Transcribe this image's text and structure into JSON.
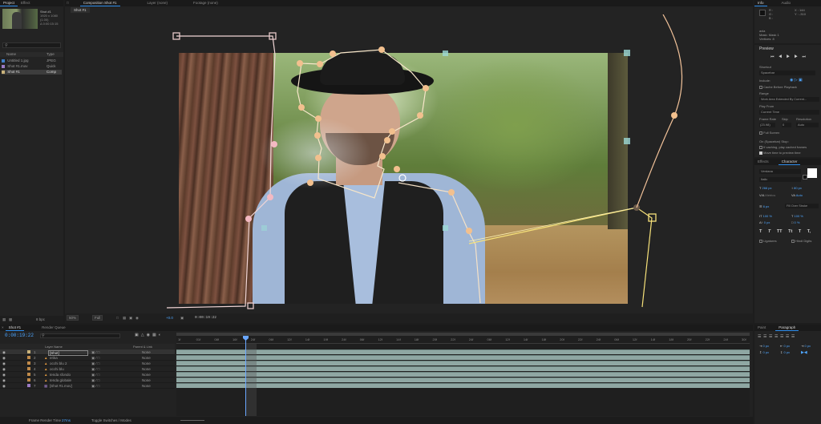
{
  "project": {
    "tabs": [
      "Project",
      "Effect"
    ],
    "thumb_name": "Shot #1",
    "thumb_info": "1920 x 1080 (1.00)",
    "thumb_time": "Δ 0:00:15:15",
    "col_name": "Name",
    "col_type": "Type",
    "items": [
      {
        "name": "Untitled 1.jpg",
        "type": "JPEG"
      },
      {
        "name": "Shot #1.mov",
        "type": "Quick"
      },
      {
        "name": "Shot #1",
        "type": "Comp"
      }
    ],
    "bpc": "8 bpc"
  },
  "viewer": {
    "tabs": [
      "Composition Shot #1",
      "Layer (none)",
      "Footage (none)"
    ],
    "subtab": "Shot #1",
    "zoom": "50%",
    "resolution": "Full",
    "timecode": "0:00:19:22",
    "exposure": "+0.0"
  },
  "right": {
    "info_tabs": [
      "Info",
      "Audio"
    ],
    "info_r": "R :",
    "info_g": "G :",
    "info_b": "B :",
    "info_x": "X : 144",
    "info_y": "Y : -310",
    "mask_lines": [
      "axia",
      "Mask: Mask 1",
      "Vertices: 8"
    ],
    "preview_tab": "Preview",
    "shortcut_label": "Shortcut",
    "shortcut_value": "Spacebar",
    "include_label": "Include:",
    "cache_label": "Cache Before Playback",
    "range_label": "Range",
    "range_value": "Work Area Extended By Current...",
    "playfrom_label": "Play From",
    "playfrom_value": "Current Time",
    "framerate_label": "Frame Rate",
    "skip_label": "Skip",
    "resolution_label": "Resolution",
    "framerate_value": "(23.98)",
    "skip_value": "0",
    "resolution_value": "Auto",
    "fullscreen_label": "Full Screen",
    "onstop_label": "On (Spacebar) Stop:",
    "ifcaching_label": "If caching, play cached frames",
    "movetime_label": "Move time to preview time",
    "char_tabs": [
      "Effects",
      "Character"
    ],
    "font_name": "Verdana",
    "font_style": "Italic",
    "font_size": "266 px",
    "leading": "80 px",
    "tracking": "Auto",
    "kerning": "Metrics",
    "stroke_size": "6 px",
    "stroke_mode": "Fill Over Stroke",
    "vscale": "100 %",
    "hscale": "100 %",
    "baseline": "0 px",
    "tsume": "0 %",
    "style_buttons": [
      "T",
      "T",
      "TT",
      "Tt",
      "T",
      "T,"
    ],
    "ligatures": "Ligatures",
    "hindi_digits": "Hindi Digits",
    "para_tabs": [
      "Paint",
      "Paragraph"
    ],
    "para_values": [
      "0 px",
      "0 px",
      "0 px",
      "0 px",
      "0 px"
    ]
  },
  "timeline": {
    "tabs": [
      "Shot #1",
      "Render Queue"
    ],
    "timecode": "0:00:19:22",
    "search_placeholder": "",
    "col_layer": "Layer Name",
    "col_parent": "Parent & Link",
    "layers": [
      {
        "num": "1",
        "name": "[Shot]",
        "parent": "None"
      },
      {
        "num": "2",
        "name": "erika",
        "parent": "None"
      },
      {
        "num": "3",
        "name": "occhi blu 2",
        "parent": "None"
      },
      {
        "num": "4",
        "name": "occhi blu",
        "parent": "None"
      },
      {
        "num": "5",
        "name": "tenda sfondo",
        "parent": "None"
      },
      {
        "num": "6",
        "name": "tenda globale",
        "parent": "None"
      },
      {
        "num": "7",
        "name": "[Shot #1.mov]",
        "parent": "None"
      }
    ],
    "ruler": [
      "1f",
      "01f",
      "08f",
      "16f",
      "24f",
      "06f",
      "12f",
      "14f",
      "19f",
      "24f",
      "06f",
      "12f",
      "14f",
      "18f",
      "20f",
      "22f",
      "24f",
      "06f",
      "12f",
      "14f",
      "18f",
      "20f",
      "22f",
      "24f",
      "06f",
      "12f",
      "14f",
      "18f",
      "20f",
      "22f",
      "24f",
      "30f"
    ],
    "footer_render": "Frame Render Time",
    "footer_render_value": "27ms",
    "footer_toggle": "Toggle Switches / Modes"
  },
  "colors": {
    "accent": "#2d8ceb",
    "timecode": "#4ea6ff",
    "mask_vertex": "#f3c39a",
    "mask_line": "#ffffff",
    "mask_yellow": "#f7e27a",
    "track": "#8fa7a3",
    "playhead": "#6aa7ff"
  }
}
